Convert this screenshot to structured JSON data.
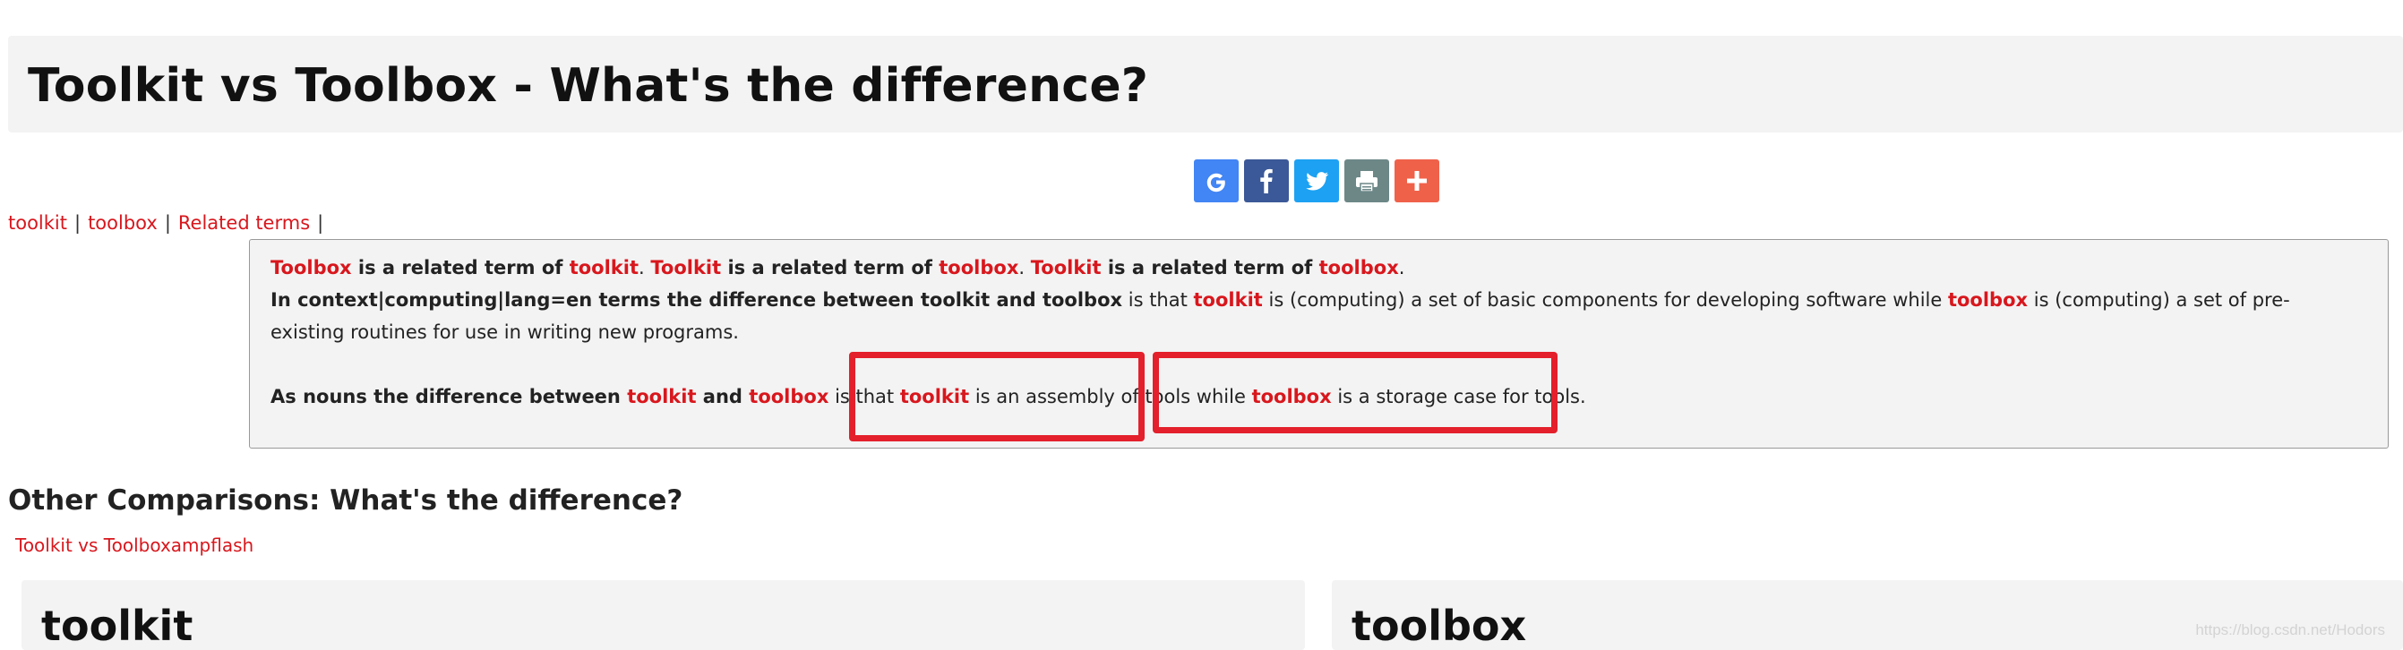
{
  "page_title": "Toolkit vs Toolbox - What's the difference?",
  "share": {
    "buttons": [
      {
        "name": "google",
        "color": "#4285f4"
      },
      {
        "name": "facebook",
        "color": "#3b5998"
      },
      {
        "name": "twitter",
        "color": "#1da1f2"
      },
      {
        "name": "print",
        "color": "#6d8787"
      },
      {
        "name": "more",
        "color": "#f0614a"
      }
    ]
  },
  "tags": {
    "toolkit": "toolkit",
    "toolbox": "toolbox",
    "related": "Related terms",
    "sep": "|"
  },
  "definition": {
    "line1": {
      "w1": "Toolbox",
      "t1": " is a related term of ",
      "w2": "toolkit",
      "t2": ". ",
      "w3": "Toolkit",
      "t3": " is a related term of ",
      "w4": "toolbox",
      "t4": ". ",
      "w5": "Toolkit",
      "t5": " is a related term of ",
      "w6": "toolbox",
      "t6": "."
    },
    "para2": {
      "b1": "In context|computing|lang=en terms the difference between toolkit and toolbox",
      "t1": " is that ",
      "k1": "toolkit",
      "t2": " is (computing) a set of basic components for developing software while ",
      "k2": "toolbox",
      "t3": " is (computing) a set of pre-existing routines for use in writing new programs."
    },
    "para3": {
      "b1": "As nouns the difference between ",
      "k1": "toolkit",
      "b2": " and ",
      "k2": "toolbox",
      "t1": " is that ",
      "k3": "toolkit",
      "t2": " is an assembly of tools while ",
      "k4": "toolbox",
      "t3": " is a storage case for tools."
    }
  },
  "other_comparisons": {
    "heading": "Other Comparisons: What's the difference?",
    "link": "Toolkit vs Toolboxampflash"
  },
  "cards": [
    {
      "title": "toolkit"
    },
    {
      "title": "toolbox"
    }
  ],
  "watermark": "https://blog.csdn.net/Hodors",
  "colors": {
    "link": "#d8171d",
    "highlight": "#e3202b",
    "panel": "#f3f3f3"
  }
}
